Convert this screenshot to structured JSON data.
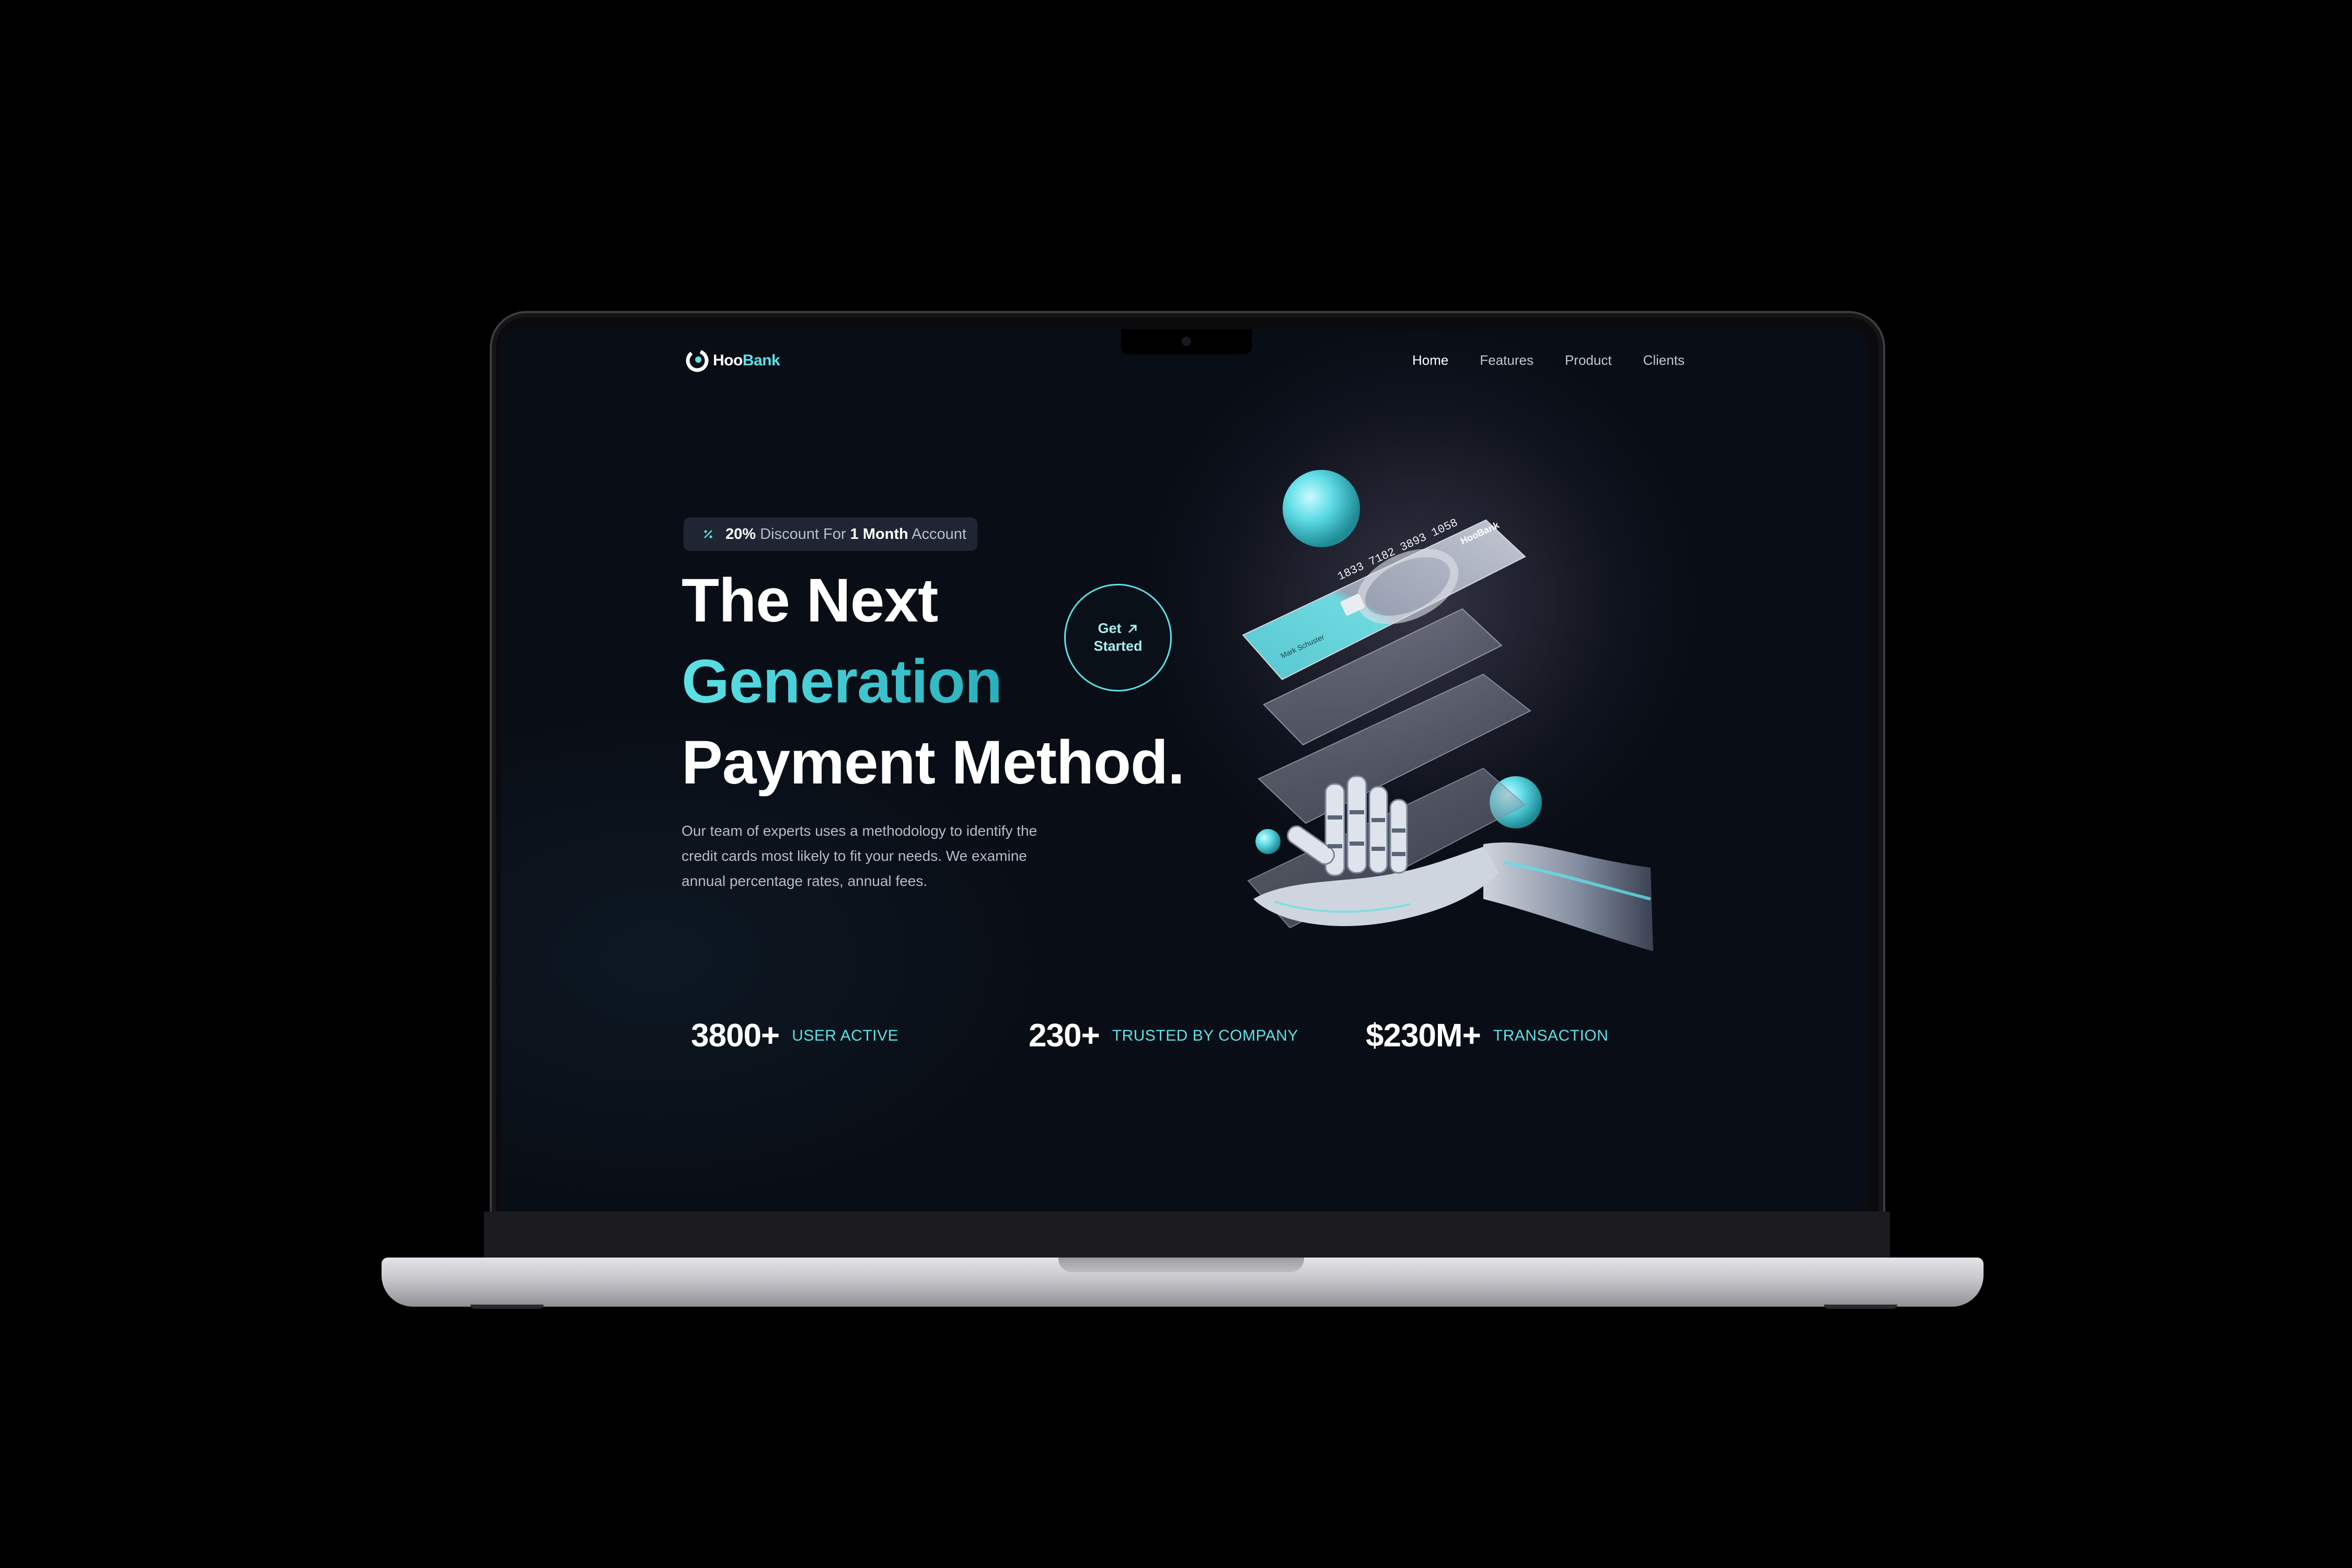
{
  "brand": {
    "name_a": "Hoo",
    "name_b": "Bank"
  },
  "nav": {
    "items": [
      "Home",
      "Features",
      "Product",
      "Clients"
    ],
    "active": "Home"
  },
  "badge": {
    "percent": "20%",
    "mid": " Discount For ",
    "bold2": "1 Month",
    "end": " Account"
  },
  "hero": {
    "line1": "The Next",
    "line2": "Generation",
    "line3": "Payment Method."
  },
  "cta": {
    "line1": "Get",
    "line2": "Started"
  },
  "description": "Our team of experts uses a methodology to identify the credit cards most likely to fit your needs. We examine annual percentage rates, annual fees.",
  "stats": [
    {
      "value": "3800+",
      "label": "USER ACTIVE"
    },
    {
      "value": "230+",
      "label": "TRUSTED BY COMPANY"
    },
    {
      "value": "$230M+",
      "label": "TRANSACTION"
    }
  ],
  "card": {
    "number": "1833 7182 3893 1058",
    "name": "Mark Schuster",
    "brand": "HooBank"
  },
  "colors": {
    "accent": "#5ce1e6",
    "background": "#090d15",
    "badge_bg": "#1f2532"
  }
}
